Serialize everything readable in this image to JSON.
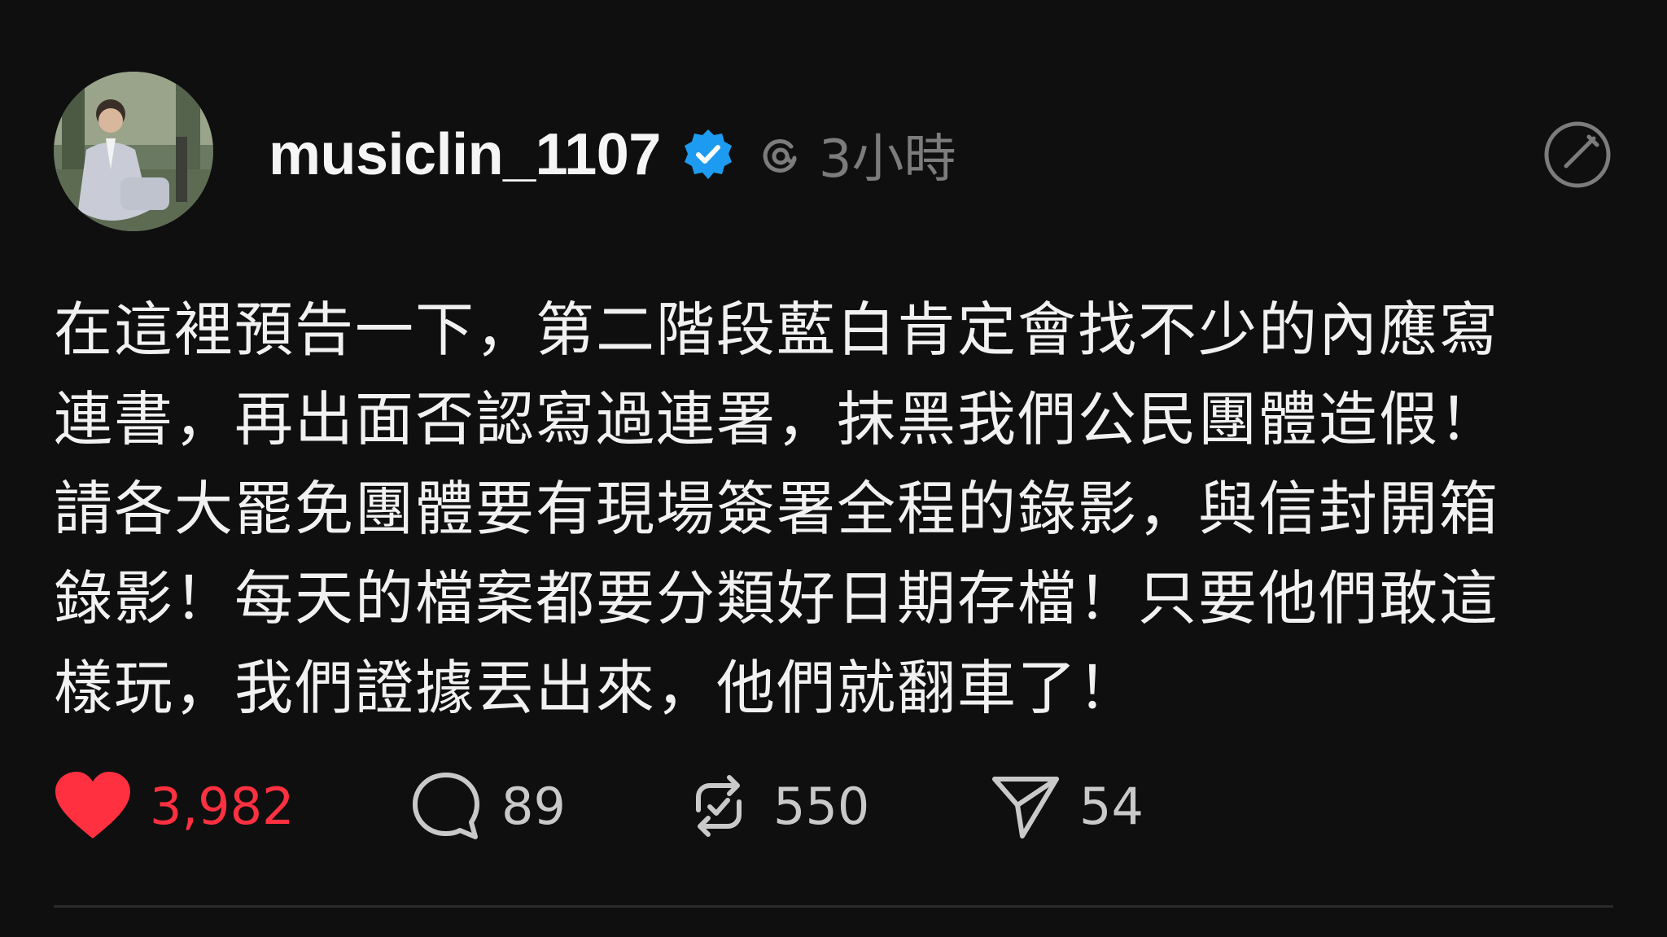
{
  "post": {
    "username": "musiclin_1107",
    "time": "3小時",
    "body": "在這裡預告一下，第二階段藍白肯定會找不少的內應寫\n連書，再出面否認寫過連署，抹黑我們公民團體造假！\n請各大罷免團體要有現場簽署全程的錄影，與信封開箱\n錄影！每天的檔案都要分類好日期存檔！只要他們敢這\n樣玩，我們證據丟出來，他們就翻車了！"
  },
  "actions": {
    "likes": "3,982",
    "replies": "89",
    "reposts": "550",
    "shares": "54"
  },
  "colors": {
    "background": "#0f0f0f",
    "like": "#ff3040",
    "verified": "#1d9bf0",
    "muted": "#7c7c7c"
  },
  "icons": [
    "avatar-photo",
    "verified-badge-icon",
    "threads-icon",
    "more-icon",
    "heart-icon",
    "comment-icon",
    "repost-icon",
    "share-icon"
  ]
}
